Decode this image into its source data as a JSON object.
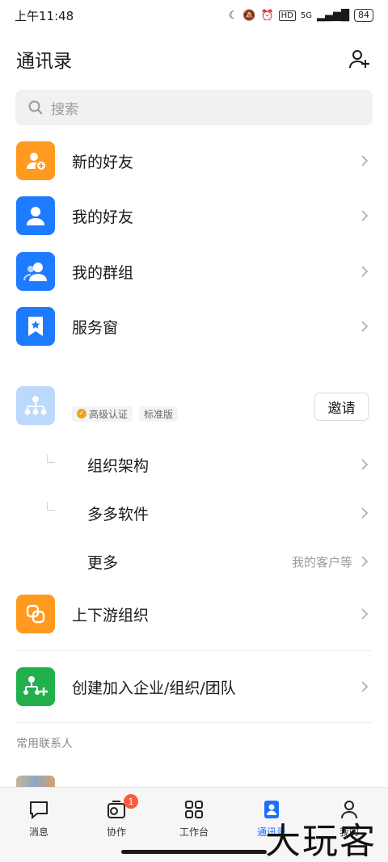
{
  "status_bar": {
    "time": "上午11:48",
    "network": "5G",
    "battery": "84"
  },
  "header": {
    "title": "通讯录"
  },
  "search": {
    "placeholder": "搜索"
  },
  "menu": [
    {
      "label": "新的好友",
      "icon": "add-user-icon",
      "color": "#ff9a1f"
    },
    {
      "label": "我的好友",
      "icon": "user-icon",
      "color": "#1e7bff"
    },
    {
      "label": "我的群组",
      "icon": "group-icon",
      "color": "#1e7bff"
    },
    {
      "label": "服务窗",
      "icon": "bookmark-star-icon",
      "color": "#1e7bff"
    }
  ],
  "organization": {
    "badge_verified": "高级认证",
    "badge_edition": "标准版",
    "invite_label": "邀请",
    "items": [
      {
        "label": "组织架构"
      },
      {
        "label": "多多软件"
      },
      {
        "label": "更多",
        "note": "我的客户等"
      }
    ]
  },
  "extra": [
    {
      "label": "上下游组织",
      "icon": "link-icon",
      "color": "#ff9a1f"
    },
    {
      "label": "创建加入企业/组织/团队",
      "icon": "create-org-icon",
      "color": "#21b04b"
    }
  ],
  "frequent": {
    "title": "常用联系人"
  },
  "tabbar": [
    {
      "label": "消息",
      "icon": "chat-icon"
    },
    {
      "label": "协作",
      "icon": "collab-icon",
      "badge": "1"
    },
    {
      "label": "工作台",
      "icon": "grid-icon"
    },
    {
      "label": "通讯录",
      "icon": "contacts-icon",
      "active": true
    },
    {
      "label": "我的",
      "icon": "profile-icon"
    }
  ],
  "watermark": "大玩客"
}
